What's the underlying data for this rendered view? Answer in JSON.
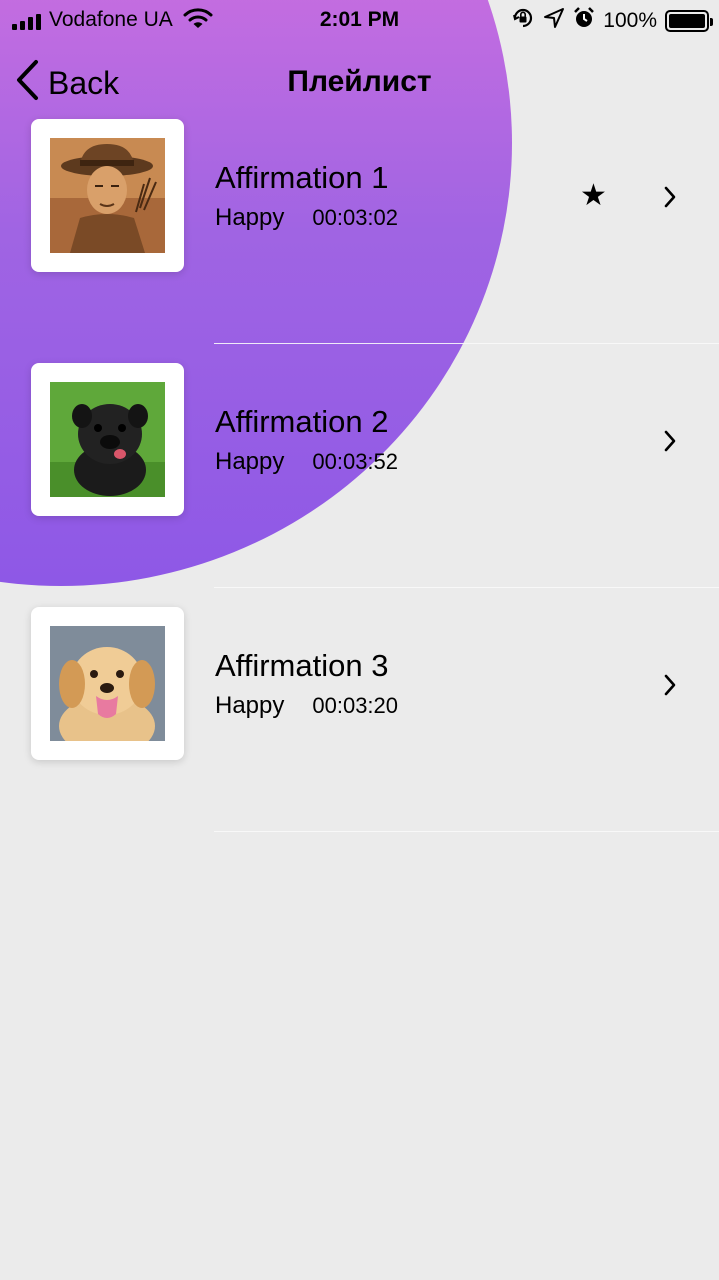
{
  "status_bar": {
    "carrier": "Vodafone UA",
    "time": "2:01 PM",
    "battery": "100%",
    "icons": [
      "signal-icon",
      "wifi-icon",
      "orientation-lock-icon",
      "location-icon",
      "alarm-icon",
      "battery-icon"
    ]
  },
  "nav": {
    "back_label": "Back",
    "title": "Плейлист"
  },
  "playlist": [
    {
      "title": "Affirmation 1",
      "mood": "Happy",
      "duration": "00:03:02",
      "favorite": true,
      "thumbnail": "adventurer-portrait"
    },
    {
      "title": "Affirmation 2",
      "mood": "Happy",
      "duration": "00:03:52",
      "favorite": false,
      "thumbnail": "black-pug-puppy"
    },
    {
      "title": "Affirmation 3",
      "mood": "Happy",
      "duration": "00:03:20",
      "favorite": false,
      "thumbnail": "golden-retriever-puppy"
    }
  ],
  "icons": {
    "favorite": "★"
  },
  "colors": {
    "background": "#ebebeb",
    "gradient_top": "#e873e3",
    "gradient_bottom": "#8e58e6"
  }
}
